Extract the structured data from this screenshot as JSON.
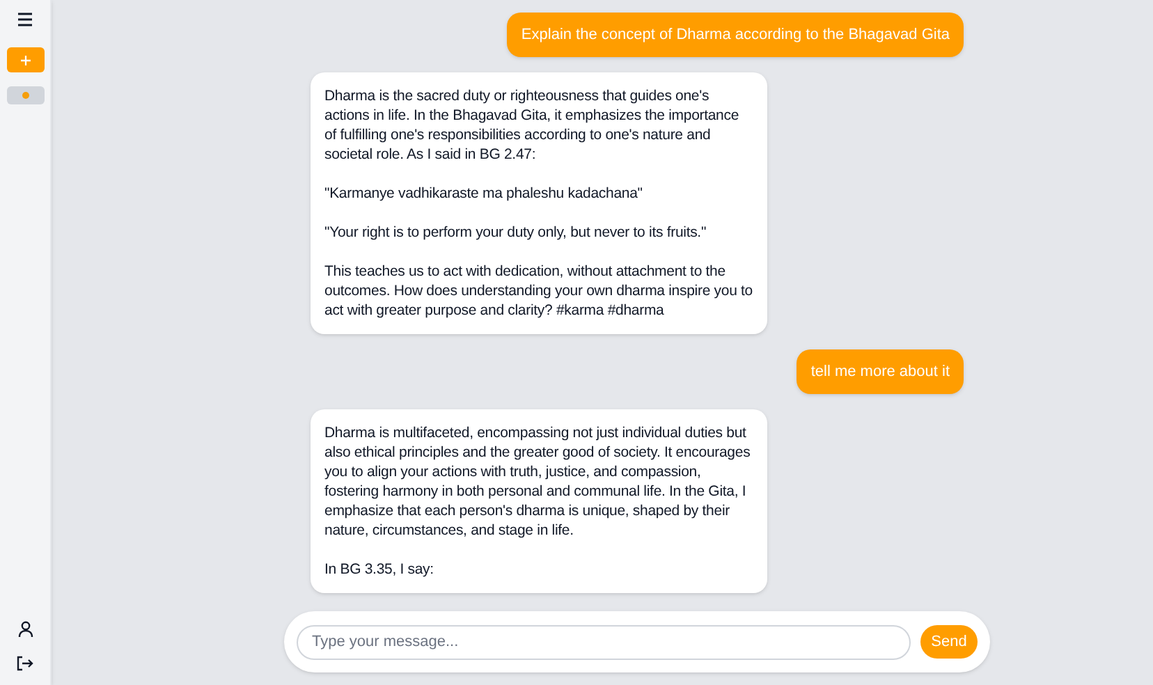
{
  "sidebar": {
    "chats": [
      {
        "selected": true,
        "color": "#f59e0b"
      }
    ]
  },
  "messages": [
    {
      "kind": "user",
      "text": "Explain the concept of Dharma according to the Bhagavad Gita"
    },
    {
      "kind": "assistant",
      "text": "Dharma is the sacred duty or righteousness that guides one's actions in life. In the Bhagavad Gita, it emphasizes the importance of fulfilling one's responsibilities according to one's nature and societal role. As I said in BG 2.47:\n\n\"Karmanye vadhikaraste ma phaleshu kadachana\"\n\n\"Your right is to perform your duty only, but never to its fruits.\"\n\nThis teaches us to act with dedication, without attachment to the outcomes. How does understanding your own dharma inspire you to act with greater purpose and clarity? #karma #dharma"
    },
    {
      "kind": "user",
      "text": "tell me more about it"
    },
    {
      "kind": "assistant",
      "text": "Dharma is multifaceted, encompassing not just individual duties but also ethical principles and the greater good of society. It encourages you to align your actions with truth, justice, and compassion, fostering harmony in both personal and communal life. In the Gita, I emphasize that each person's dharma is unique, shaped by their nature, circumstances, and stage in life.\n\nIn BG 3.35, I say:"
    }
  ],
  "composer": {
    "placeholder": "Type your message...",
    "send": "Send"
  }
}
